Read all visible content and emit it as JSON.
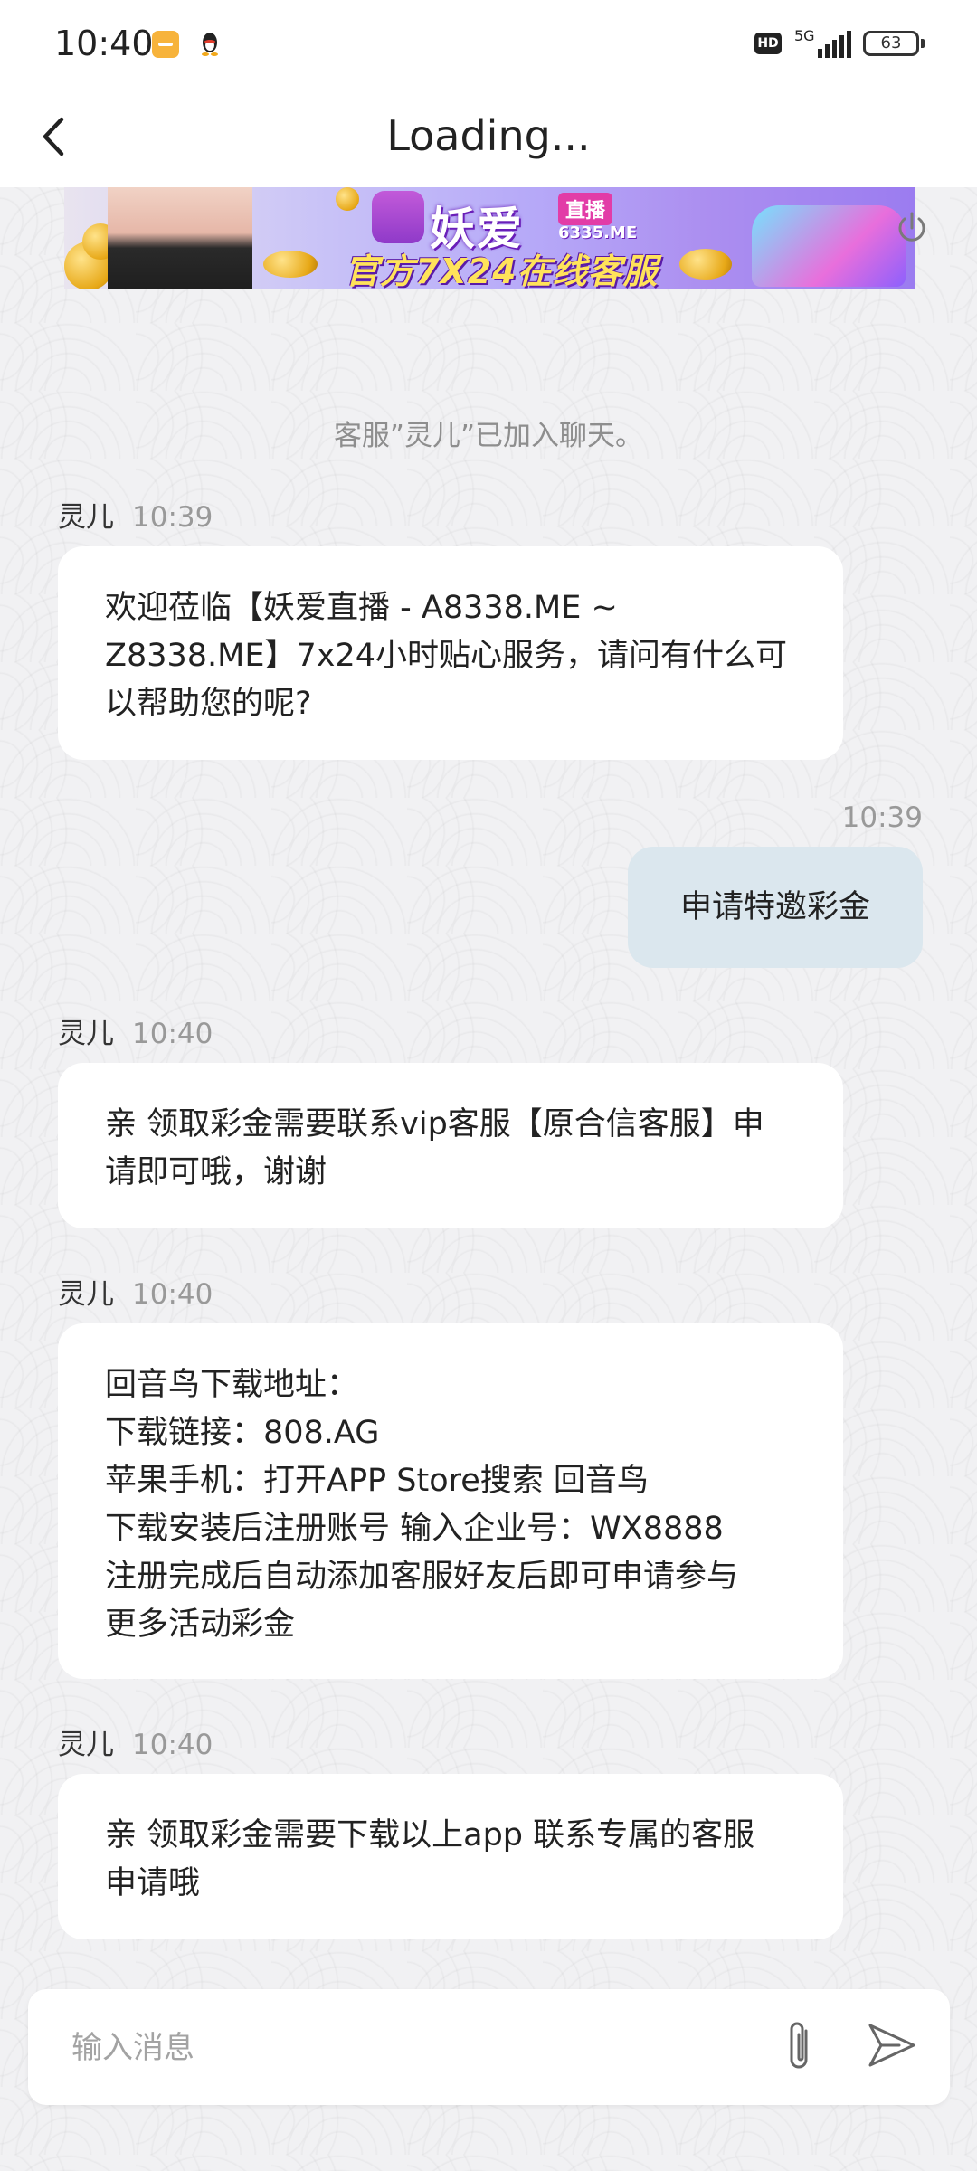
{
  "status_bar": {
    "time": "10:40",
    "hd": "HD",
    "network": "5G",
    "battery": "63"
  },
  "header": {
    "title": "Loading..."
  },
  "banner": {
    "brand": "妖爱",
    "live_badge": "直播",
    "domain": "6335.ME",
    "slogan": "官方7X24在线客服"
  },
  "system_notice": "客服”灵儿”已加入聊天。",
  "messages": [
    {
      "sender": "灵儿",
      "time": "10:39",
      "lines": [
        "欢迎莅临【妖爱直播 - A8338.ME ~",
        "Z8338.ME】7x24小时贴心服务，请问有什么可",
        "以帮助您的呢?"
      ]
    },
    {
      "outgoing": true,
      "time": "10:39",
      "text": "申请特邀彩金"
    },
    {
      "sender": "灵儿",
      "time": "10:40",
      "lines": [
        "亲 领取彩金需要联系vip客服【原合信客服】申",
        "请即可哦，谢谢"
      ]
    },
    {
      "sender": "灵儿",
      "time": "10:40",
      "lines": [
        "回音鸟下载地址：",
        "下载链接：808.AG",
        "苹果手机：打开APP Store搜索 回音鸟",
        "下载安装后注册账号 输入企业号：WX8888",
        "注册完成后自动添加客服好友后即可申请参与",
        "更多活动彩金"
      ]
    },
    {
      "sender": "灵儿",
      "time": "10:40",
      "lines": [
        "亲 领取彩金需要下载以上app 联系专属的客服",
        "申请哦"
      ]
    }
  ],
  "input": {
    "placeholder": "输入消息",
    "value": ""
  },
  "icons": {
    "back": "back-arrow-icon",
    "power": "power-icon",
    "attach": "paperclip-icon",
    "send": "send-icon"
  }
}
